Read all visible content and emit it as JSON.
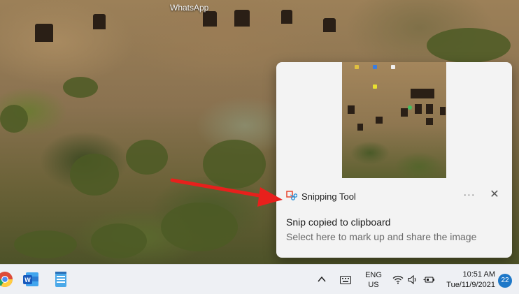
{
  "desktop": {
    "label": "WhatsApp"
  },
  "notification": {
    "app_name": "Snipping Tool",
    "more_icon": "more-horizontal-icon",
    "close_icon": "close-icon",
    "title": "Snip copied to clipboard",
    "body": "Select here to mark up and share the image"
  },
  "taskbar": {
    "apps": [
      {
        "name": "chrome",
        "icon": "chrome-icon"
      },
      {
        "name": "word",
        "icon": "word-icon"
      },
      {
        "name": "notepad",
        "icon": "notepad-icon"
      }
    ],
    "tray": {
      "chevron_icon": "chevron-up-icon",
      "keyboard_icon": "keyboard-icon",
      "language_line1": "ENG",
      "language_line2": "US",
      "wifi_icon": "wifi-icon",
      "volume_icon": "volume-icon",
      "battery_icon": "battery-icon",
      "time": "10:51 AM",
      "date": "Tue/11/9/2021",
      "notification_count": "22"
    }
  },
  "colors": {
    "accent": "#1e78c8",
    "arrow": "#e8201c"
  }
}
